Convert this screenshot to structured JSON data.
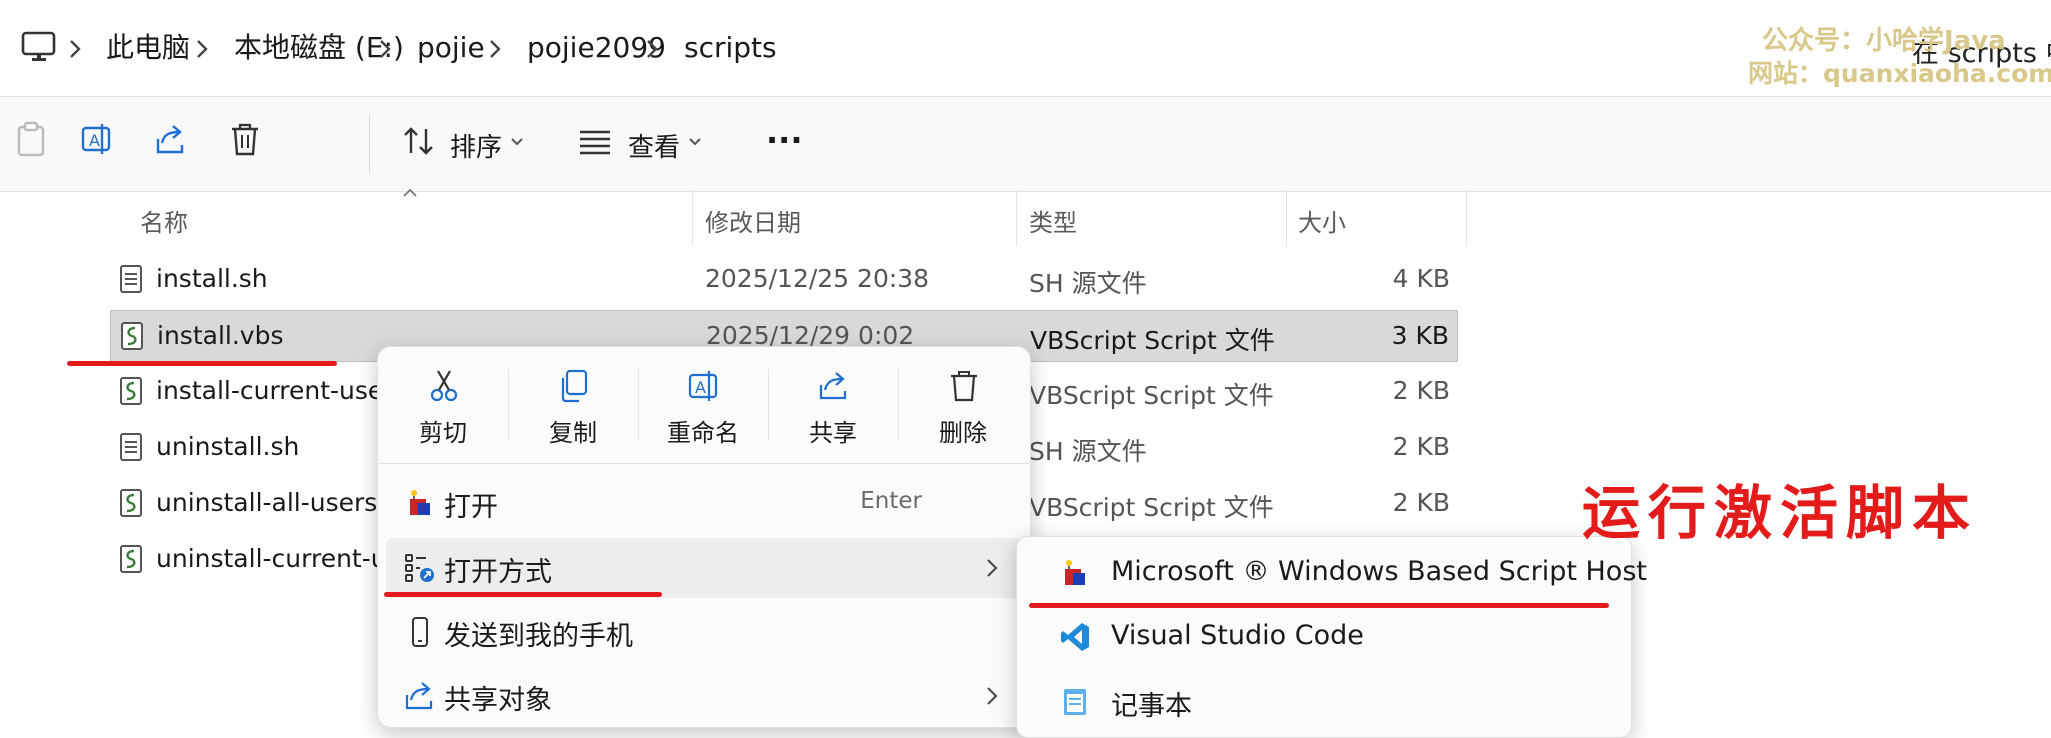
{
  "breadcrumb": {
    "items": [
      "此电脑",
      "本地磁盘 (E:)",
      "pojie",
      "pojie2099",
      "scripts"
    ],
    "search_placeholder": "在 scripts 中"
  },
  "watermark": {
    "line1": "公众号：小哈学Java",
    "line2": "网站：quanxiaoha.com"
  },
  "toolbar": {
    "sort_label": "排序",
    "view_label": "查看",
    "more_label": "···"
  },
  "columns": {
    "name": "名称",
    "date": "修改日期",
    "type": "类型",
    "size": "大小"
  },
  "files": [
    {
      "name": "install.sh",
      "date": "2025/12/25 20:38",
      "type": "SH 源文件",
      "size": "4 KB"
    },
    {
      "name": "install.vbs",
      "date": "2025/12/29 0:02",
      "type": "VBScript Script 文件",
      "size": "3 KB"
    },
    {
      "name": "install-current-user",
      "date": "",
      "type": "VBScript Script 文件",
      "size": "2 KB"
    },
    {
      "name": "uninstall.sh",
      "date": "",
      "type": "SH 源文件",
      "size": "2 KB"
    },
    {
      "name": "uninstall-all-users.v",
      "date": "",
      "type": "VBScript Script 文件",
      "size": "2 KB"
    },
    {
      "name": "uninstall-current-us",
      "date": "",
      "type": "",
      "size": ""
    }
  ],
  "context_menu": {
    "quick_actions": [
      "剪切",
      "复制",
      "重命名",
      "共享",
      "删除"
    ],
    "items": [
      {
        "label": "打开",
        "shortcut": "Enter"
      },
      {
        "label": "打开方式"
      },
      {
        "label": "发送到我的手机"
      },
      {
        "label": "共享对象"
      }
    ]
  },
  "submenu": {
    "items": [
      "Microsoft ® Windows Based Script Host",
      "Visual Studio Code",
      "记事本"
    ]
  },
  "annotation": {
    "text": "运行激活脚本"
  },
  "colors": {
    "annotation_red": "#e31b1b",
    "selection_bg": "#d9d9d9",
    "accent_blue": "#1f6fd1"
  }
}
